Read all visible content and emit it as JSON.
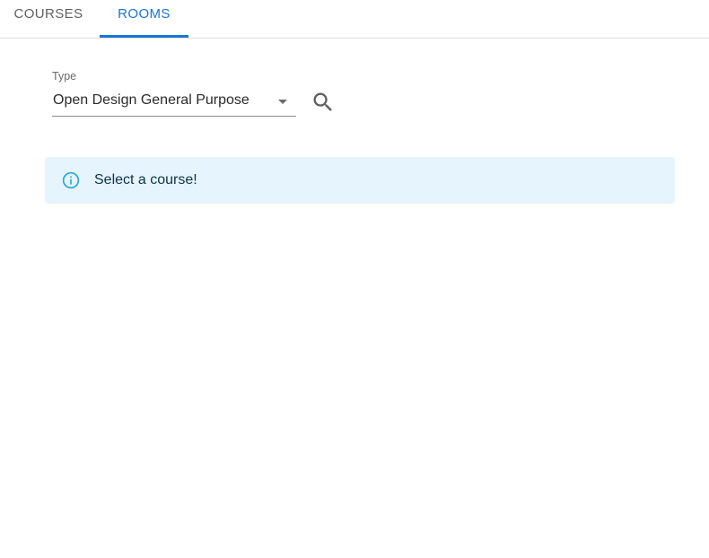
{
  "tabs": {
    "courses_label": "COURSES",
    "rooms_label": "ROOMS",
    "active": "ROOMS"
  },
  "filter": {
    "type_label": "Type",
    "type_value": "Open Design General Purpose"
  },
  "alert": {
    "message": "Select a course!",
    "severity": "info"
  },
  "colors": {
    "accent": "#1976d2",
    "info_bg": "#e6f4fd",
    "info_icon": "#29a8dd"
  },
  "icons": {
    "search": "search-icon",
    "dropdown": "arrow-drop-down-icon",
    "info": "info-outline-icon"
  }
}
